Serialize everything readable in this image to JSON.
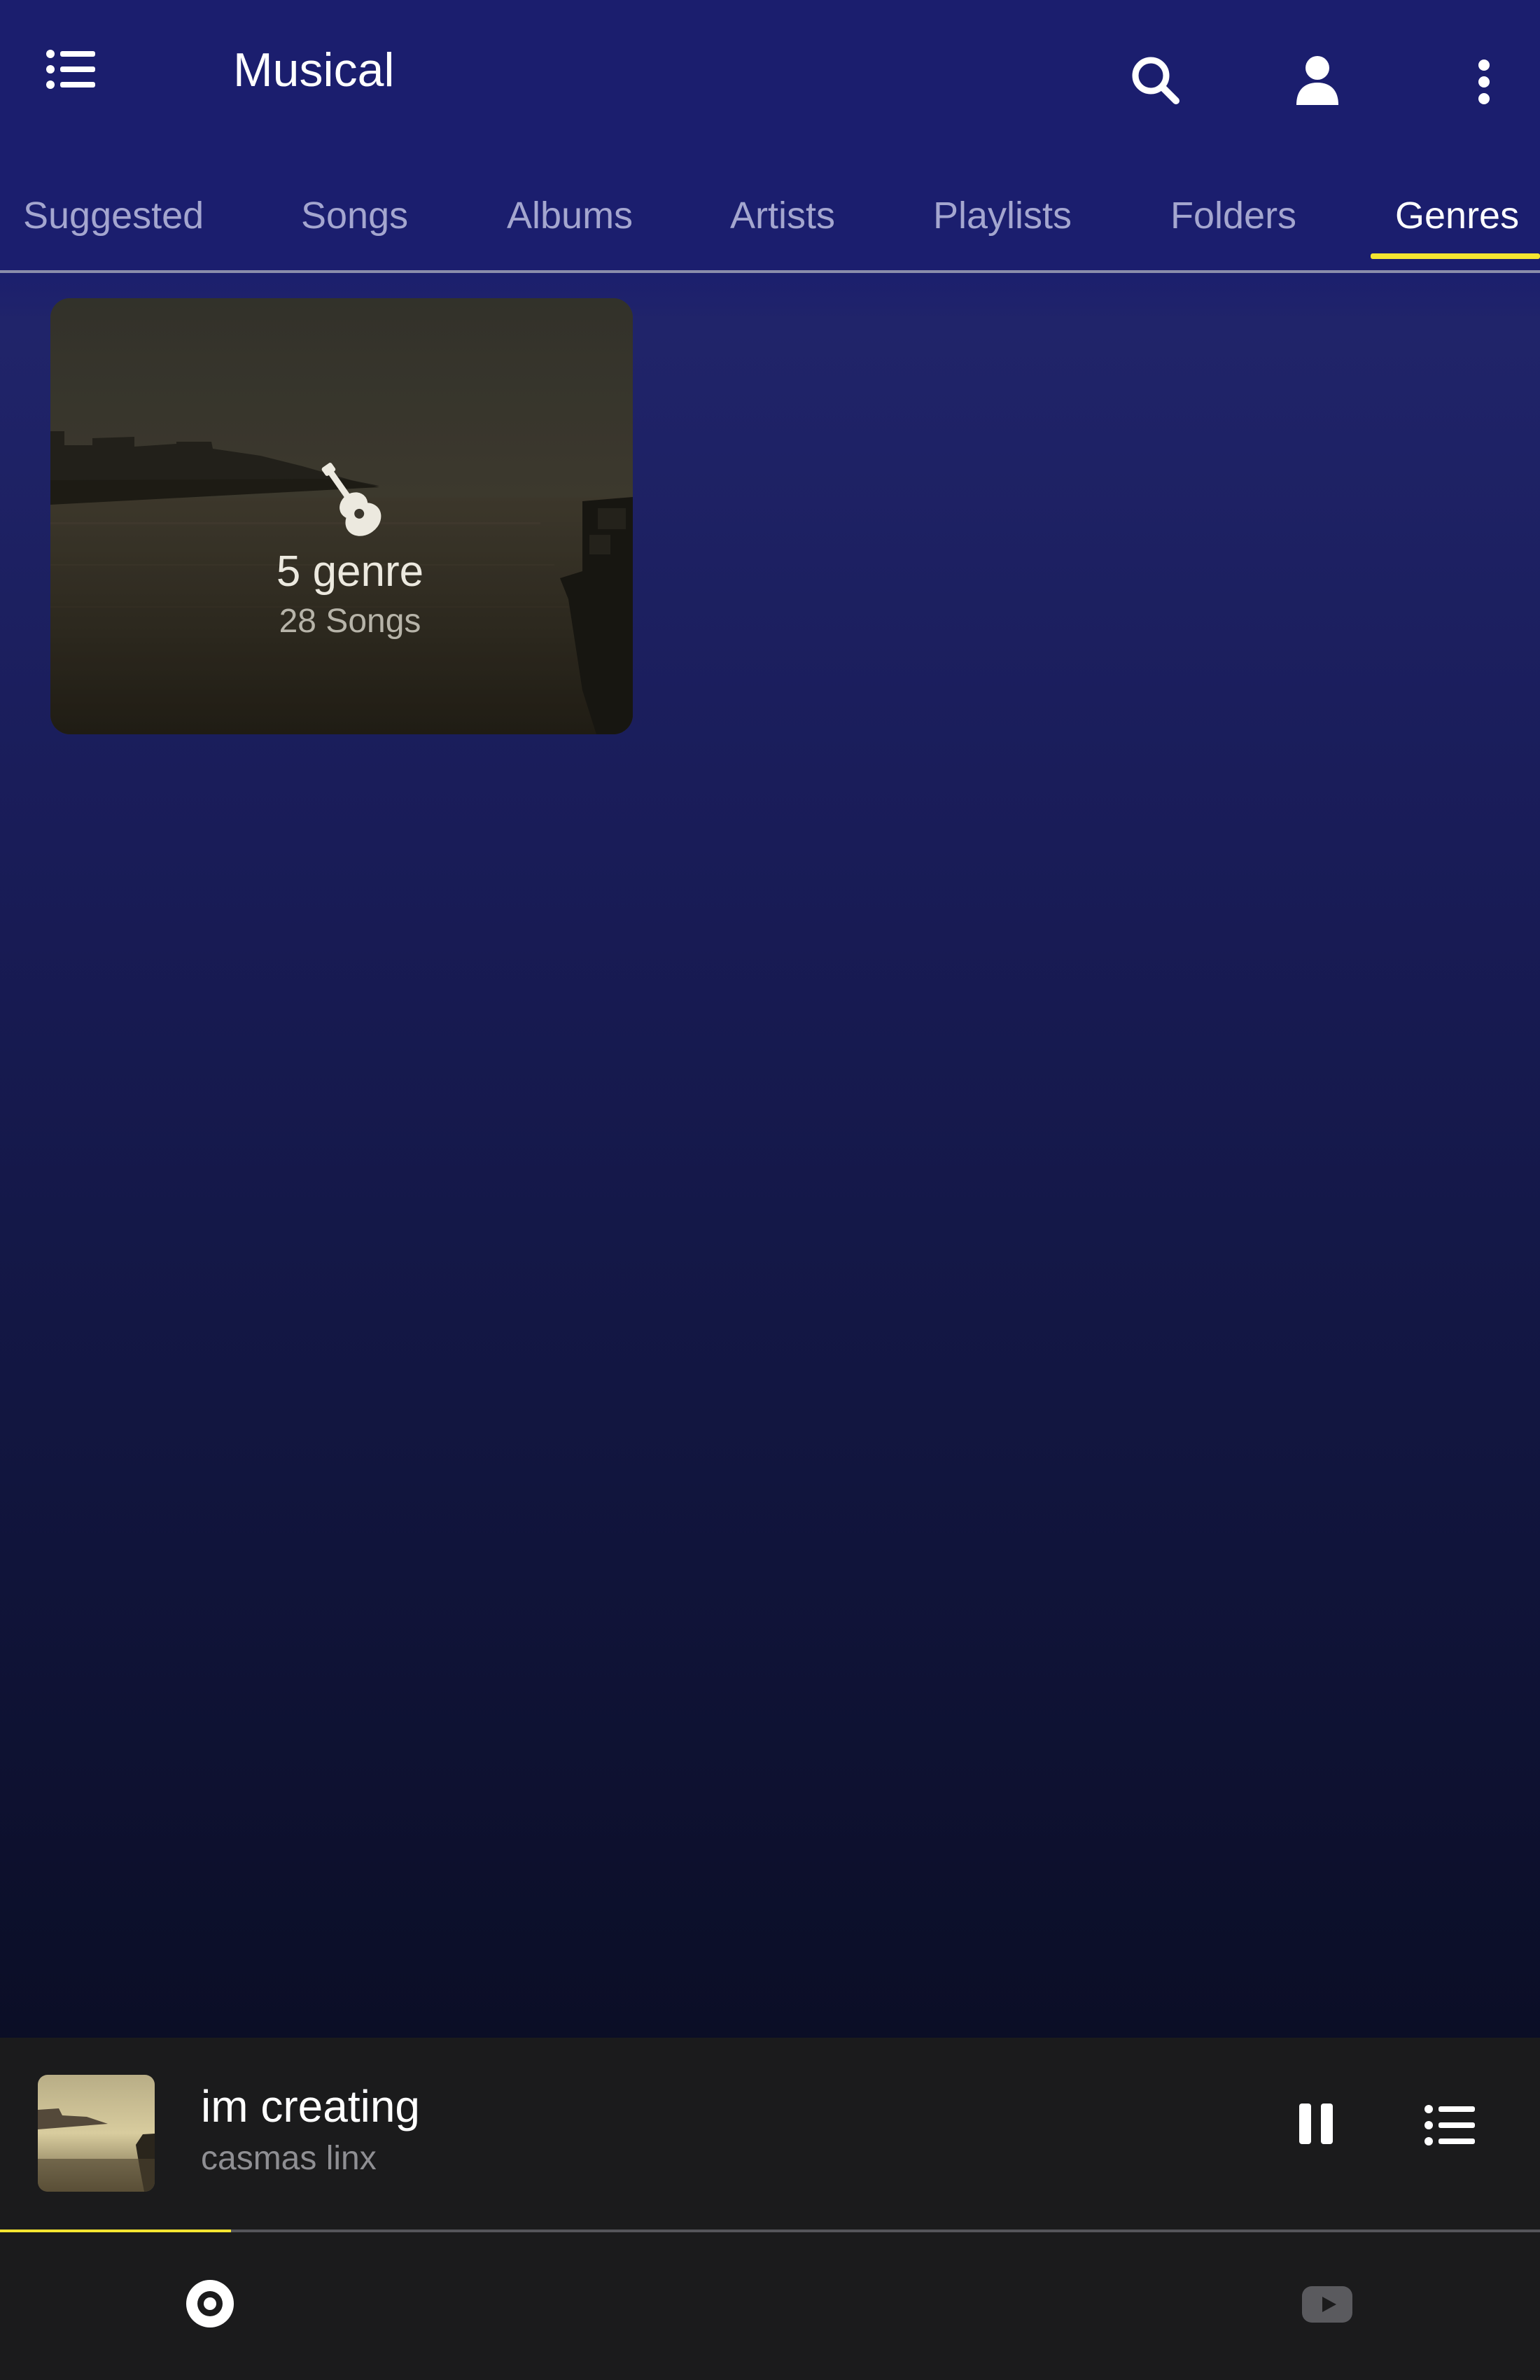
{
  "app": {
    "title": "Musical",
    "icons": {
      "menu": "list-menu-icon",
      "search": "search-icon",
      "account": "person-icon",
      "more": "more-vert-icon"
    }
  },
  "tabs": [
    {
      "label": "Suggested",
      "active": false
    },
    {
      "label": "Songs",
      "active": false
    },
    {
      "label": "Albums",
      "active": false
    },
    {
      "label": "Artists",
      "active": false
    },
    {
      "label": "Playlists",
      "active": false
    },
    {
      "label": "Folders",
      "active": false
    },
    {
      "label": "Genres",
      "active": true
    }
  ],
  "genres": [
    {
      "name": "5 genre",
      "count": "28 Songs",
      "icon": "guitar-icon"
    }
  ],
  "now_playing": {
    "title": "im creating",
    "artist": "casmas linx",
    "progress": 0.15,
    "state": "playing"
  },
  "bottom_nav": {
    "left_icon": "disc-icon",
    "right_icon": "youtube-icon"
  },
  "colors": {
    "accent": "#f4e530",
    "header_bg": "#1b1e6e",
    "player_bg": "#1b1b1c"
  }
}
